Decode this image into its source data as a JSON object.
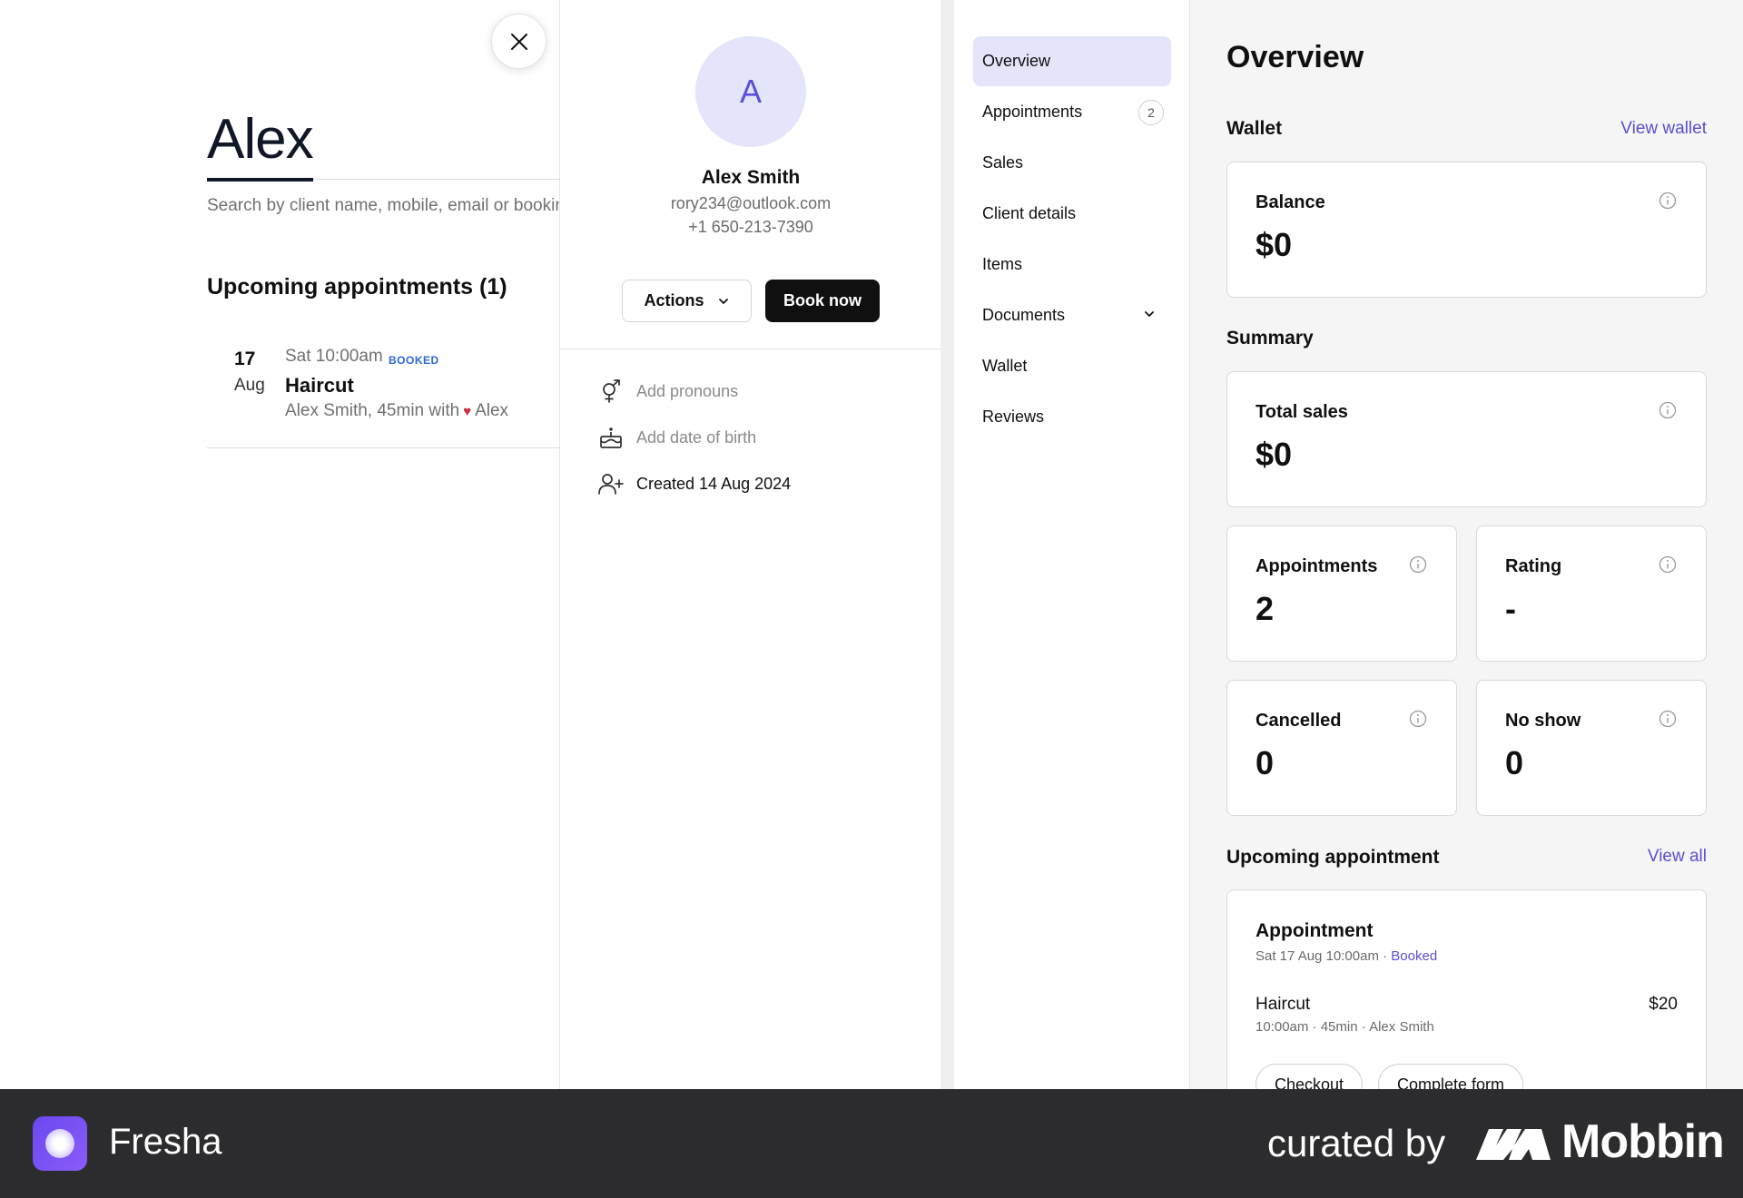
{
  "search": {
    "title": "Alex",
    "placeholder": "Search by client name, mobile, email or booking"
  },
  "upcoming": {
    "heading": "Upcoming appointments (1)",
    "appointment": {
      "day": "17",
      "month": "Aug",
      "time": "Sat 10:00am",
      "status": "BOOKED",
      "service": "Haircut",
      "details_prefix": "Alex Smith, 45min with",
      "staff": "Alex"
    }
  },
  "profile": {
    "initial": "A",
    "name": "Alex Smith",
    "email": "rory234@outlook.com",
    "phone": "+1 650-213-7390",
    "actions_label": "Actions",
    "book_label": "Book now",
    "pronouns": "Add pronouns",
    "dob": "Add date of birth",
    "created": "Created 14 Aug 2024"
  },
  "nav": {
    "items": [
      {
        "label": "Overview"
      },
      {
        "label": "Appointments",
        "count": "2"
      },
      {
        "label": "Sales"
      },
      {
        "label": "Client details"
      },
      {
        "label": "Items"
      },
      {
        "label": "Documents"
      },
      {
        "label": "Wallet"
      },
      {
        "label": "Reviews"
      }
    ]
  },
  "overview": {
    "title": "Overview",
    "wallet": {
      "heading": "Wallet",
      "link": "View wallet",
      "balance_label": "Balance",
      "balance_value": "$0"
    },
    "summary": {
      "heading": "Summary",
      "total_sales_label": "Total sales",
      "total_sales_value": "$0",
      "appointments_label": "Appointments",
      "appointments_value": "2",
      "rating_label": "Rating",
      "rating_value": "-",
      "cancelled_label": "Cancelled",
      "cancelled_value": "0",
      "noshow_label": "No show",
      "noshow_value": "0"
    },
    "upcoming": {
      "heading": "Upcoming appointment",
      "link": "View all",
      "card_title": "Appointment",
      "date": "Sat 17 Aug 10:00am",
      "status": "Booked",
      "service": "Haircut",
      "price": "$20",
      "time": "10:00am",
      "duration": "45min",
      "staff": "Alex Smith",
      "checkout": "Checkout",
      "complete_form": "Complete form"
    }
  },
  "footer": {
    "brand": "Fresha",
    "curated": "curated by",
    "mobbin": "Mobbin"
  },
  "colors": {
    "accent": "#5a4fd6",
    "accent_bg": "#e4e4fb",
    "status_blue": "#2c68d9",
    "heart": "#d12d3b",
    "footer_bg": "#2c2c2e"
  },
  "icons": [
    "close-icon",
    "chevron-down-icon",
    "gender-icon",
    "cake-icon",
    "user-plus-icon",
    "info-icon",
    "heart-icon",
    "fresha-logo-icon",
    "mobbin-logo-icon"
  ]
}
